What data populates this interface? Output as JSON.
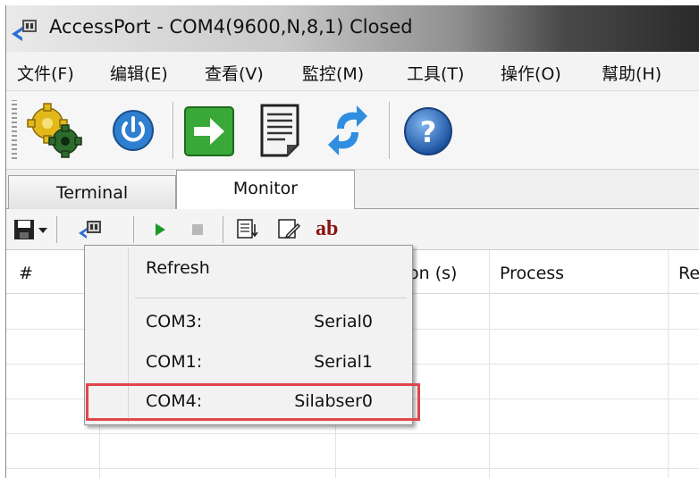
{
  "window": {
    "title": "AccessPort - COM4(9600,N,8,1) Closed"
  },
  "menu": [
    "文件(F)",
    "编辑(E)",
    "查看(V)",
    "監控(M)",
    "工具(T)",
    "操作(O)",
    "幫助(H)"
  ],
  "toolbar": {
    "icons": [
      "config-gear-icon",
      "power-icon",
      "connect-arrow-icon",
      "document-icon",
      "refresh-arrows-icon",
      "help-icon"
    ]
  },
  "tabs": [
    "Terminal",
    "Monitor"
  ],
  "active_tab": "Monitor",
  "monitor_toolbar": {
    "icons": [
      "save-icon",
      "dropdown-arrow-icon",
      "port-select-icon",
      "play-icon",
      "stop-icon",
      "capture-icon",
      "edit-icon"
    ],
    "ab_label": "ab"
  },
  "table": {
    "headers": [
      "#",
      "on (s)",
      "Process",
      "Re"
    ]
  },
  "dropdown": {
    "refresh_label": "Refresh",
    "ports": [
      {
        "port": "COM3:",
        "device": "Serial0"
      },
      {
        "port": "COM1:",
        "device": "Serial1"
      },
      {
        "port": "COM4:",
        "device": "Silabser0"
      }
    ],
    "highlighted_index": 2
  },
  "colors": {
    "highlight": "#e0464a",
    "ab_text": "#8a1414",
    "play": "#1a9a2a"
  }
}
